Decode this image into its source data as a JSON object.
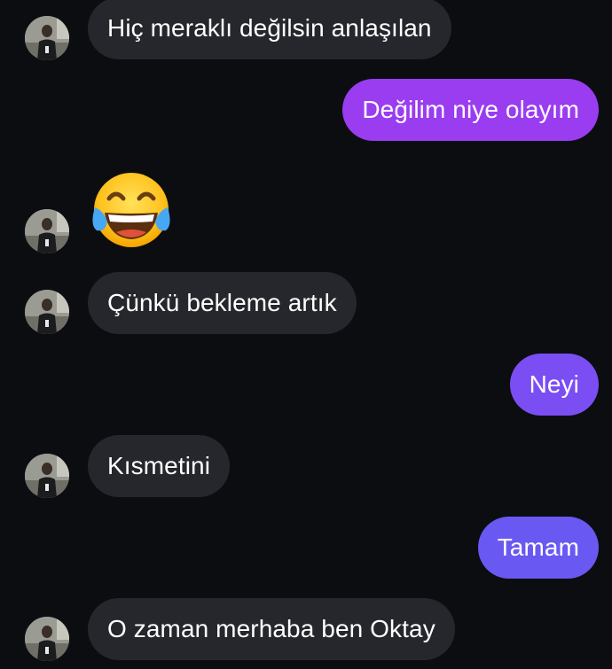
{
  "colors": {
    "background": "#0b0d11",
    "incoming_bubble": "#25272c",
    "outgoing_gradient": [
      "#9a3cf0",
      "#8a44f2",
      "#7b4ef4",
      "#6a58f2"
    ]
  },
  "messages": [
    {
      "direction": "incoming",
      "text": "Hiç meraklı değilsin anlaşılan",
      "avatar": true
    },
    {
      "direction": "outgoing",
      "text": "Değilim niye olayım"
    },
    {
      "direction": "incoming",
      "emoji": "face-with-tears-of-joy-icon",
      "text": "😂",
      "avatar": true
    },
    {
      "direction": "incoming",
      "text": "Çünkü bekleme artık",
      "avatar": true
    },
    {
      "direction": "outgoing",
      "text": "Neyi"
    },
    {
      "direction": "incoming",
      "text": "Kısmetini",
      "avatar": true
    },
    {
      "direction": "outgoing",
      "text": "Tamam"
    },
    {
      "direction": "incoming",
      "text": "O zaman merhaba ben Oktay",
      "avatar": true
    }
  ]
}
